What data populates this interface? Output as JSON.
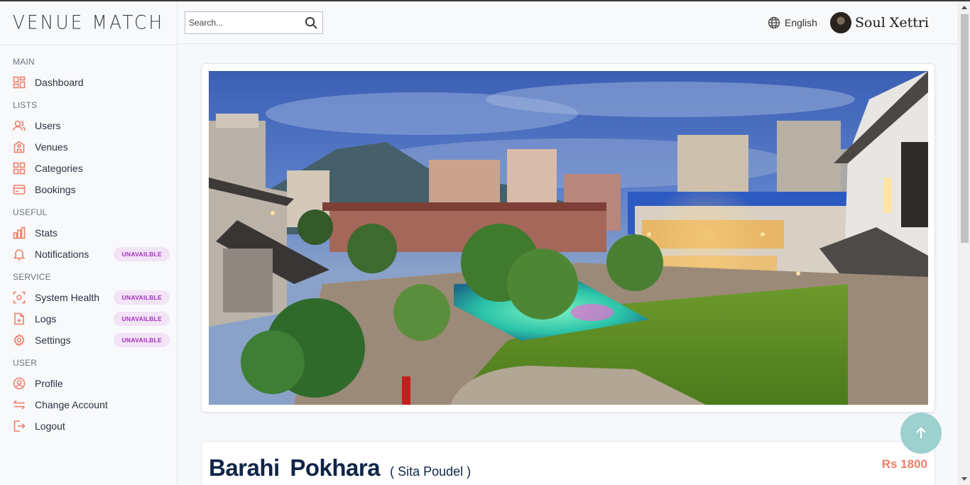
{
  "app": {
    "logo": "VENUE MATCH"
  },
  "sidebar": {
    "sections": [
      {
        "title": "MAIN",
        "items": [
          {
            "label": "Dashboard",
            "icon": "grid-icon"
          }
        ]
      },
      {
        "title": "LISTS",
        "items": [
          {
            "label": "Users",
            "icon": "users-icon"
          },
          {
            "label": "Venues",
            "icon": "building-icon"
          },
          {
            "label": "Categories",
            "icon": "grid-icon"
          },
          {
            "label": "Bookings",
            "icon": "card-icon"
          }
        ]
      },
      {
        "title": "USEFUL",
        "items": [
          {
            "label": "Stats",
            "icon": "bar-chart-icon"
          },
          {
            "label": "Notifications",
            "icon": "bell-icon",
            "badge": "UNAVAILBLE"
          }
        ]
      },
      {
        "title": "SERVICE",
        "items": [
          {
            "label": "System Health",
            "icon": "scan-icon",
            "badge": "UNAVAILBLE"
          },
          {
            "label": "Logs",
            "icon": "file-icon",
            "badge": "UNAVAILBLE"
          },
          {
            "label": "Settings",
            "icon": "gear-icon",
            "badge": "UNAVAILBLE"
          }
        ]
      },
      {
        "title": "USER",
        "items": [
          {
            "label": "Profile",
            "icon": "user-circle-icon"
          },
          {
            "label": "Change Account",
            "icon": "swap-icon"
          },
          {
            "label": "Logout",
            "icon": "logout-icon"
          }
        ]
      }
    ]
  },
  "topbar": {
    "search_placeholder": "Search...",
    "language": "English",
    "user_name": "Soul Xettri"
  },
  "venue": {
    "name": "Barahi  Pokhara",
    "owner": "( Sita Poudel )",
    "price": "Rs 1800"
  },
  "colors": {
    "accent": "#ee7f6a",
    "badge_text": "#a52fbf",
    "badge_bg": "#f2e3f6",
    "title": "#0e2547",
    "fab": "#9dd1cf"
  }
}
